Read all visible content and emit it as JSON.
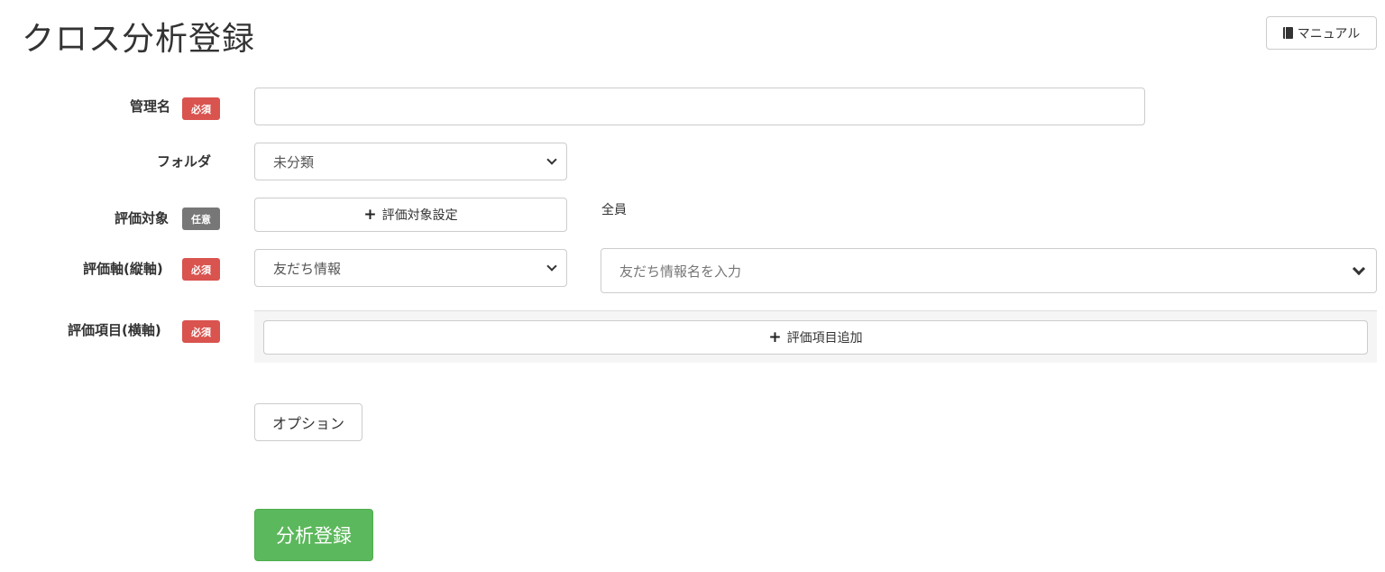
{
  "header": {
    "title": "クロス分析登録",
    "manual_label": "マニュアル",
    "manual_icon": "book-icon"
  },
  "badges": {
    "required": "必須",
    "optional": "任意"
  },
  "form": {
    "management_name": {
      "label": "管理名",
      "value": "",
      "placeholder": ""
    },
    "folder": {
      "label": "フォルダ",
      "selected": "未分類"
    },
    "target": {
      "label": "評価対象",
      "button_label": "評価対象設定",
      "value_text": "全員"
    },
    "vertical_axis": {
      "label": "評価軸(縦軸)",
      "type_selected": "友だち情報",
      "name_placeholder": "友だち情報名を入力"
    },
    "horizontal_items": {
      "label": "評価項目(横軸)",
      "add_button_label": "評価項目追加"
    },
    "options_button_label": "オプション",
    "submit_label": "分析登録"
  },
  "colors": {
    "required_badge": "#d9534f",
    "optional_badge": "#777777",
    "submit_green": "#5cb85c"
  }
}
